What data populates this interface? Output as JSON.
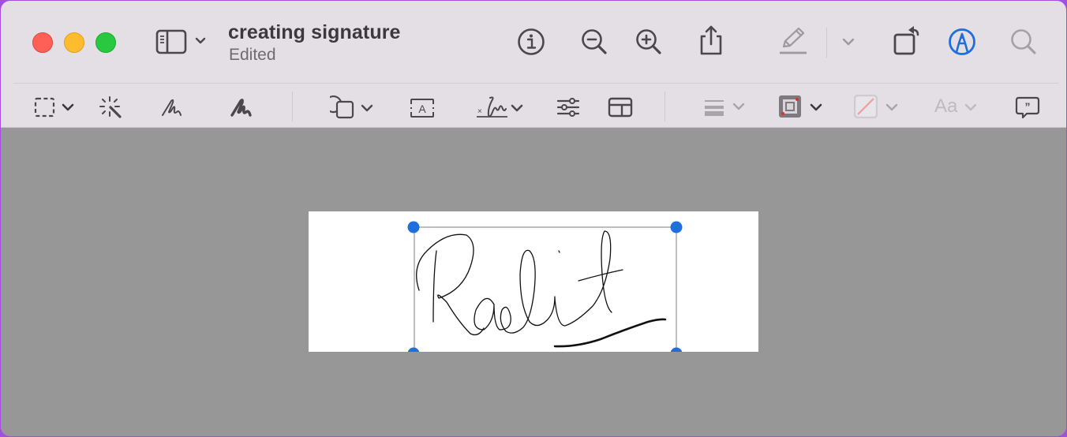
{
  "window": {
    "title": "creating signature",
    "subtitle": "Edited",
    "accent_color": "#1e6fdc",
    "traffic_lights": [
      {
        "name": "close",
        "color": "#fe5f57"
      },
      {
        "name": "minimize",
        "color": "#febc2e"
      },
      {
        "name": "zoom",
        "color": "#28c840"
      }
    ]
  },
  "toolbar": {
    "items": [
      {
        "id": "sidebar-toggle",
        "icon": "sidebar-icon",
        "has_menu": true
      },
      {
        "id": "info",
        "icon": "info-icon"
      },
      {
        "id": "zoom-out",
        "icon": "zoom-out-icon"
      },
      {
        "id": "zoom-in",
        "icon": "zoom-in-icon"
      },
      {
        "id": "share",
        "icon": "share-icon"
      },
      {
        "id": "highlight",
        "icon": "highlighter-icon",
        "enabled": false,
        "has_menu": true
      },
      {
        "id": "rotate",
        "icon": "rotate-left-icon"
      },
      {
        "id": "markup",
        "icon": "markup-icon",
        "active": true
      },
      {
        "id": "search",
        "icon": "search-icon",
        "enabled": false
      }
    ]
  },
  "markup_toolbar": {
    "items": [
      {
        "id": "selection-tools",
        "icon": "rectangular-selection-icon",
        "has_menu": true
      },
      {
        "id": "instant-alpha",
        "icon": "magic-wand-icon"
      },
      {
        "id": "sketch",
        "icon": "sketch-icon"
      },
      {
        "id": "draw",
        "icon": "draw-icon"
      },
      {
        "id": "shapes",
        "icon": "shapes-icon",
        "has_menu": true
      },
      {
        "id": "text",
        "icon": "text-box-icon"
      },
      {
        "id": "sign",
        "icon": "signature-icon",
        "has_menu": true
      },
      {
        "id": "adjust-color",
        "icon": "sliders-icon"
      },
      {
        "id": "adjust-size",
        "icon": "page-layout-icon"
      },
      {
        "id": "shape-style",
        "icon": "line-style-icon",
        "enabled": false,
        "has_menu": true
      },
      {
        "id": "border-color",
        "icon": "border-color-icon",
        "has_menu": true
      },
      {
        "id": "fill-color",
        "icon": "fill-color-icon",
        "enabled": false,
        "has_menu": true
      },
      {
        "id": "text-style",
        "icon": "text-style-icon",
        "label": "Aa",
        "enabled": false,
        "has_menu": true
      },
      {
        "id": "annotate",
        "icon": "speech-bubble-quote-icon"
      }
    ]
  },
  "document": {
    "signature_text": "Raelit",
    "selection": {
      "selected": true
    }
  }
}
